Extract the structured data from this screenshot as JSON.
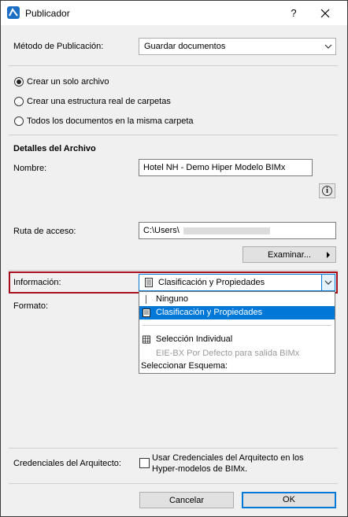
{
  "window": {
    "title": "Publicador",
    "help_label": "?",
    "close_icon": "close-icon"
  },
  "method": {
    "label": "Método de Publicación:",
    "value": "Guardar documentos"
  },
  "radio_options": [
    {
      "label": "Crear un solo archivo",
      "selected": true
    },
    {
      "label": "Crear una estructura real de carpetas",
      "selected": false
    },
    {
      "label": "Todos los documentos en la misma carpeta",
      "selected": false
    }
  ],
  "details": {
    "heading": "Detalles del Archivo",
    "name_label": "Nombre:",
    "name_value": "Hotel NH - Demo Hiper Modelo BIMx",
    "info_icon": "info-icon",
    "path_label": "Ruta de acceso:",
    "path_value": "C:\\Users\\",
    "browse_label": "Examinar..."
  },
  "information": {
    "label": "Información:",
    "value": "Clasificación y Propiedades",
    "options": [
      {
        "label": "Ninguno",
        "icon": "none-icon",
        "enabled": true,
        "selected": false
      },
      {
        "label": "Clasificación y Propiedades",
        "icon": "document-icon",
        "enabled": true,
        "selected": true
      },
      {
        "label": "Selección Individual",
        "icon": "table-icon",
        "enabled": true,
        "selected": false
      },
      {
        "label": "EIE-BX Por Defecto para salida BIMx",
        "icon": "",
        "enabled": false,
        "selected": false
      },
      {
        "label": "Seleccionar Esquema:",
        "icon": "",
        "enabled": true,
        "selected": false
      }
    ]
  },
  "format": {
    "label": "Formato:"
  },
  "credentials": {
    "label": "Credenciales del Arquitecto:",
    "checkbox_label_line1": "Usar Credenciales del Arquitecto en los",
    "checkbox_label_line2": "Hyper-modelos de BIMx.",
    "checked": false
  },
  "footer": {
    "cancel_label": "Cancelar",
    "ok_label": "OK"
  },
  "colors": {
    "highlight_border": "#a80f1c",
    "selection_bg": "#0078d7",
    "dialog_bg": "#f0f0f0"
  }
}
